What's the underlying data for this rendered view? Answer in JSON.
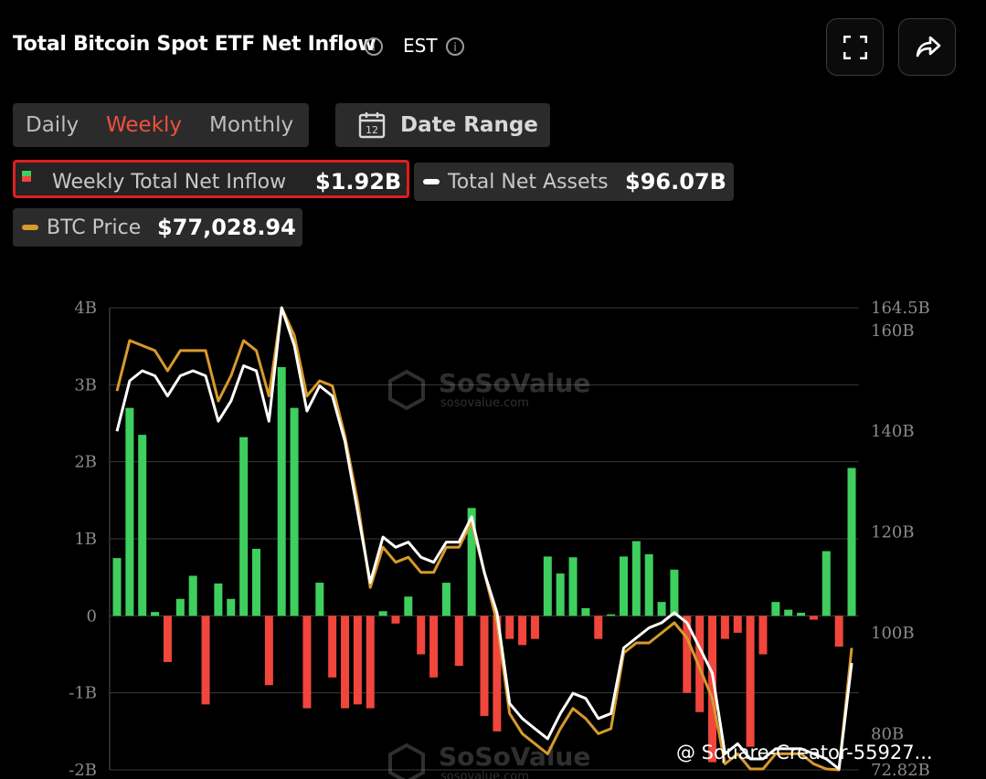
{
  "header": {
    "title": "Total Bitcoin Spot ETF Net Inflow",
    "timezone": "EST"
  },
  "toolbar": {
    "periods": [
      "Daily",
      "Weekly",
      "Monthly"
    ],
    "active_period": "Weekly",
    "date_range_label": "Date Range",
    "date_range_icon_text": "12"
  },
  "legend": {
    "inflow": {
      "label": "Weekly Total Net Inflow",
      "value": "$1.92B"
    },
    "assets": {
      "label": "Total Net Assets",
      "value": "$96.07B"
    },
    "price": {
      "label": "BTC Price",
      "value": "$77,028.94"
    }
  },
  "footer_watermark": "@ Square-Creator-55927...",
  "colors": {
    "positive": "#3ecf5e",
    "negative": "#f0463c",
    "price": "#d79a2b",
    "assets": "#ffffff",
    "accent": "#f0503c"
  },
  "chart_data": {
    "type": "bar",
    "title": "Total Bitcoin Spot ETF Net Inflow",
    "left_axis": {
      "ticks": [
        "4B",
        "3B",
        "2B",
        "1B",
        "0",
        "-1B",
        "-2B"
      ],
      "ylim": [
        -2,
        4
      ],
      "unit": "B"
    },
    "right_axis": {
      "ticks": [
        "164.5B",
        "160B",
        "140B",
        "120B",
        "100B",
        "80B",
        "72.82B"
      ],
      "ylim": [
        72.82,
        164.5
      ],
      "unit": "B"
    },
    "series": [
      {
        "name": "Weekly Total Net Inflow",
        "axis": "left",
        "type": "bar",
        "values": [
          0.75,
          2.7,
          2.35,
          0.05,
          -0.6,
          0.22,
          0.52,
          -1.15,
          0.42,
          0.22,
          2.32,
          0.87,
          -0.9,
          3.23,
          2.7,
          -1.2,
          0.43,
          -0.8,
          -1.2,
          -1.15,
          -1.2,
          0.06,
          -0.1,
          0.25,
          -0.5,
          -0.8,
          0.43,
          -0.65,
          1.4,
          -1.3,
          -1.5,
          -0.3,
          -0.38,
          -0.3,
          0.77,
          0.55,
          0.76,
          0.1,
          -0.3,
          0.02,
          0.77,
          0.97,
          0.8,
          0.18,
          0.6,
          -1.0,
          -1.25,
          -1.9,
          -0.3,
          -0.22,
          -1.7,
          -0.5,
          0.18,
          0.08,
          0.04,
          -0.05,
          0.84,
          -0.4,
          1.92
        ]
      },
      {
        "name": "Total Net Assets",
        "axis": "right",
        "type": "line",
        "values": [
          140,
          150,
          152,
          151,
          147,
          151,
          152,
          151,
          142,
          146,
          153,
          152,
          142,
          164.5,
          157,
          144,
          149,
          147,
          138,
          124,
          110,
          119,
          117,
          118,
          115,
          114,
          118,
          118,
          123,
          112,
          104,
          86,
          83,
          81,
          79,
          84,
          88,
          87,
          83,
          84,
          97,
          99,
          101,
          102,
          104,
          102,
          97,
          92,
          76,
          78,
          75,
          75,
          77,
          77,
          77,
          76,
          75,
          73,
          94
        ]
      },
      {
        "name": "BTC Price",
        "axis": "right",
        "type": "line",
        "values": [
          148,
          158,
          157,
          156,
          152,
          156,
          156,
          156,
          146,
          151,
          158,
          156,
          147,
          164.5,
          159,
          147,
          150,
          149,
          139,
          126,
          109,
          117,
          114,
          115,
          112,
          112,
          117,
          117,
          122,
          112,
          102,
          84,
          80,
          78,
          76,
          81,
          85,
          83,
          80,
          81,
          96,
          98,
          98,
          100,
          102,
          99,
          93,
          87,
          74,
          76,
          73,
          73,
          76,
          76,
          76,
          74,
          73,
          72.82,
          97
        ]
      }
    ]
  }
}
